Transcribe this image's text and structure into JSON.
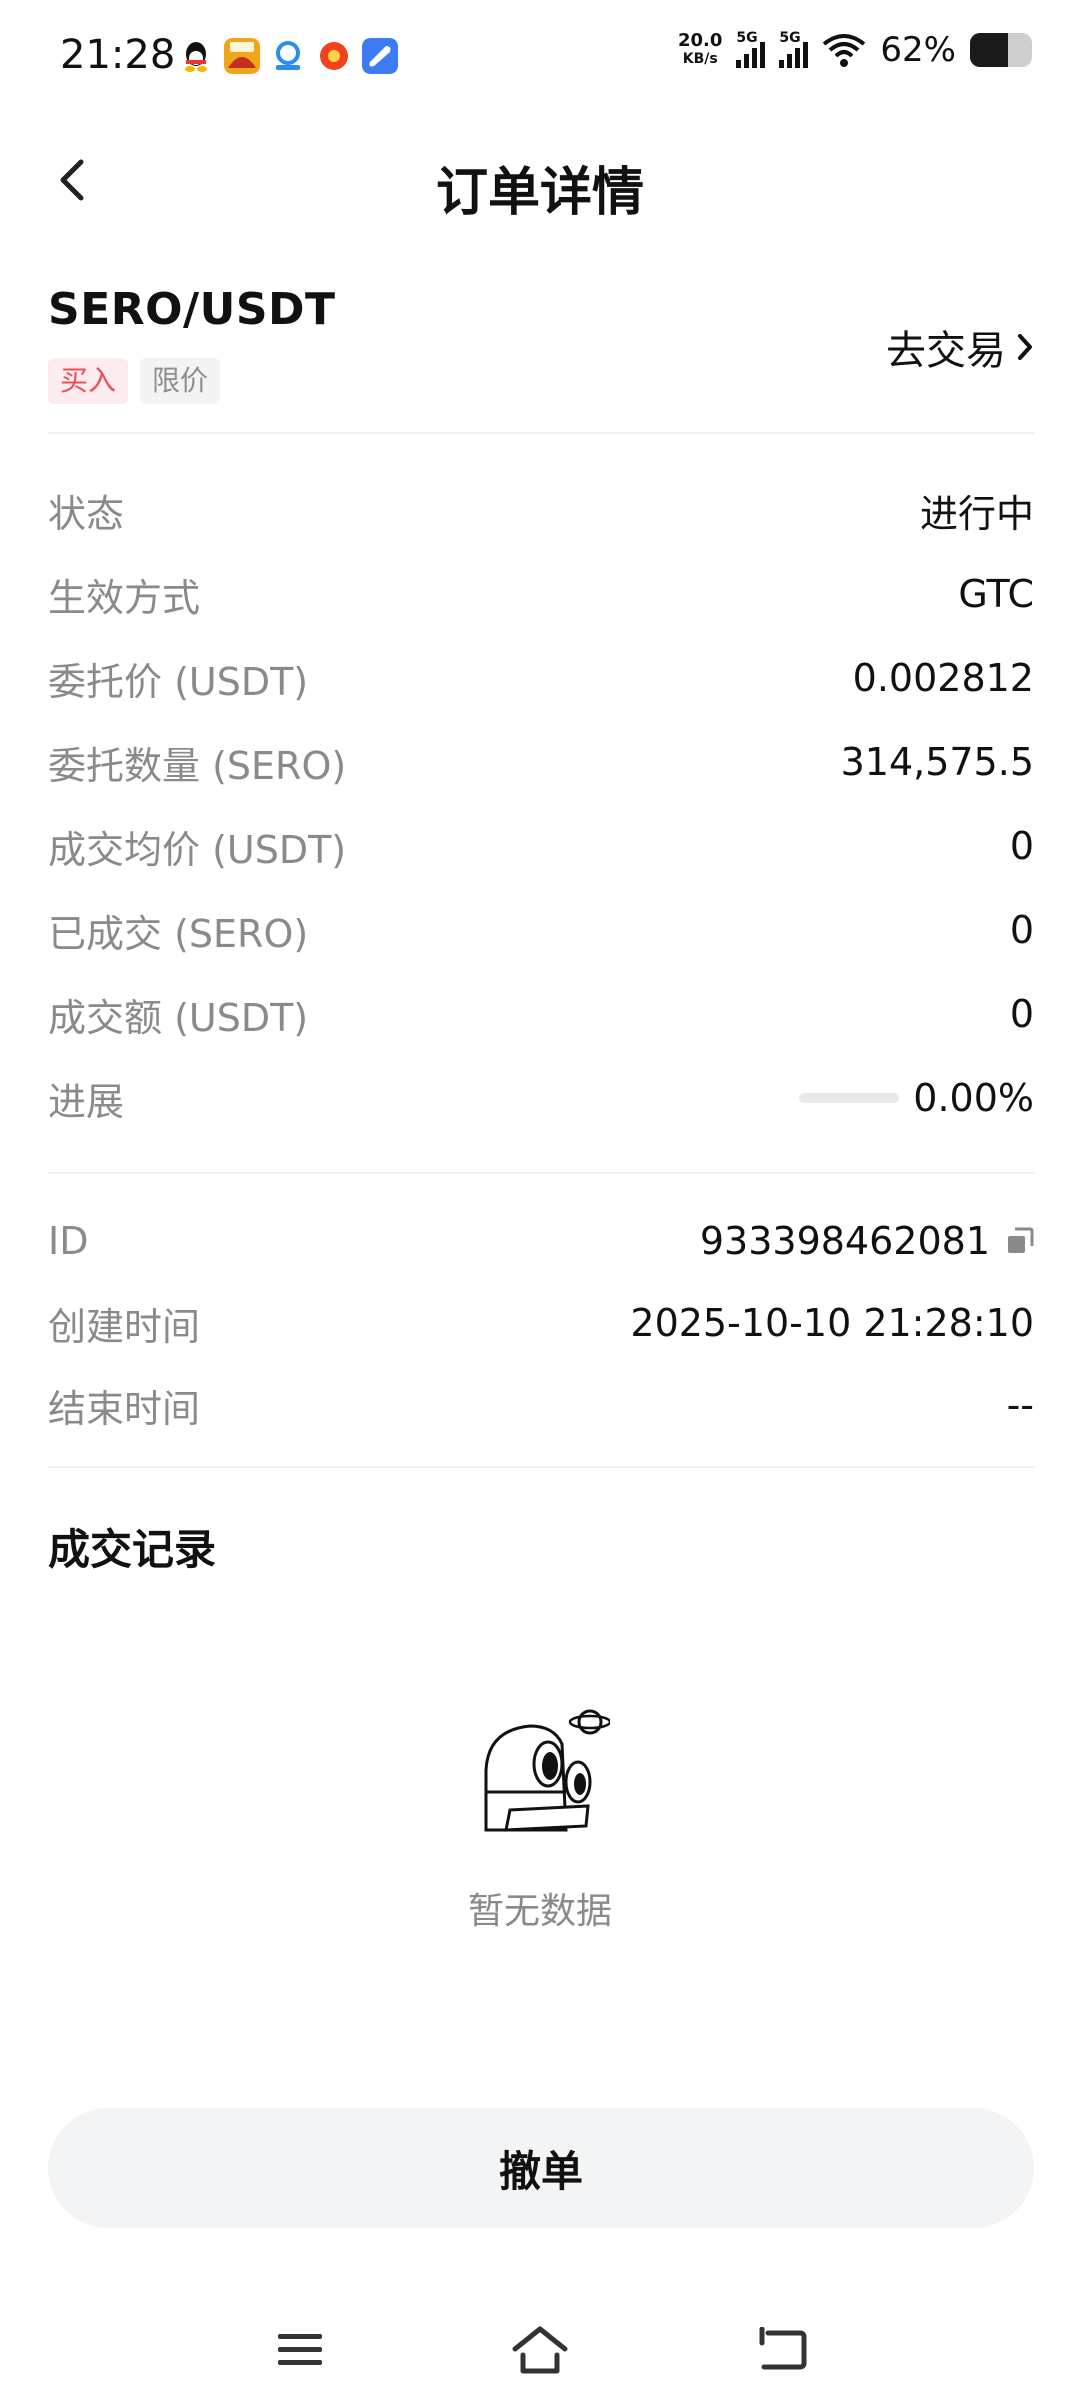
{
  "status_bar": {
    "time": "21:28",
    "net_speed": "20.0",
    "net_unit": "KB/s",
    "signal1_label": "5G",
    "signal2_label": "5G",
    "battery_pct": "62%",
    "battery_level": 0.62
  },
  "header": {
    "title": "订单详情",
    "back_icon": "chevron-left-icon"
  },
  "order": {
    "pair": "SERO/USDT",
    "side_tag": "买入",
    "type_tag": "限价",
    "go_trade": "去交易",
    "details": [
      {
        "label": "状态",
        "value": "进行中"
      },
      {
        "label": "生效方式",
        "value": "GTC"
      },
      {
        "label": "委托价 (USDT)",
        "value": "0.002812"
      },
      {
        "label": "委托数量 (SERO)",
        "value": "314,575.5"
      },
      {
        "label": "成交均价 (USDT)",
        "value": "0"
      },
      {
        "label": "已成交 (SERO)",
        "value": "0"
      },
      {
        "label": "成交额 (USDT)",
        "value": "0"
      },
      {
        "label": "进展",
        "value": "0.00%"
      }
    ],
    "progress_fraction": 0.0,
    "meta": [
      {
        "label": "ID",
        "value": "933398462081"
      },
      {
        "label": "创建时间",
        "value": "2025-10-10 21:28:10"
      },
      {
        "label": "结束时间",
        "value": "--"
      }
    ]
  },
  "records": {
    "title": "成交记录",
    "empty_text": "暂无数据",
    "empty_icon": "astronaut-binoculars-icon"
  },
  "actions": {
    "cancel_label": "撤单"
  },
  "colors": {
    "buy_red": "#ef4d5a",
    "buy_tag_bg": "#fdeced",
    "muted_text": "#8a8a8a",
    "button_bg": "#f3f4f5"
  }
}
